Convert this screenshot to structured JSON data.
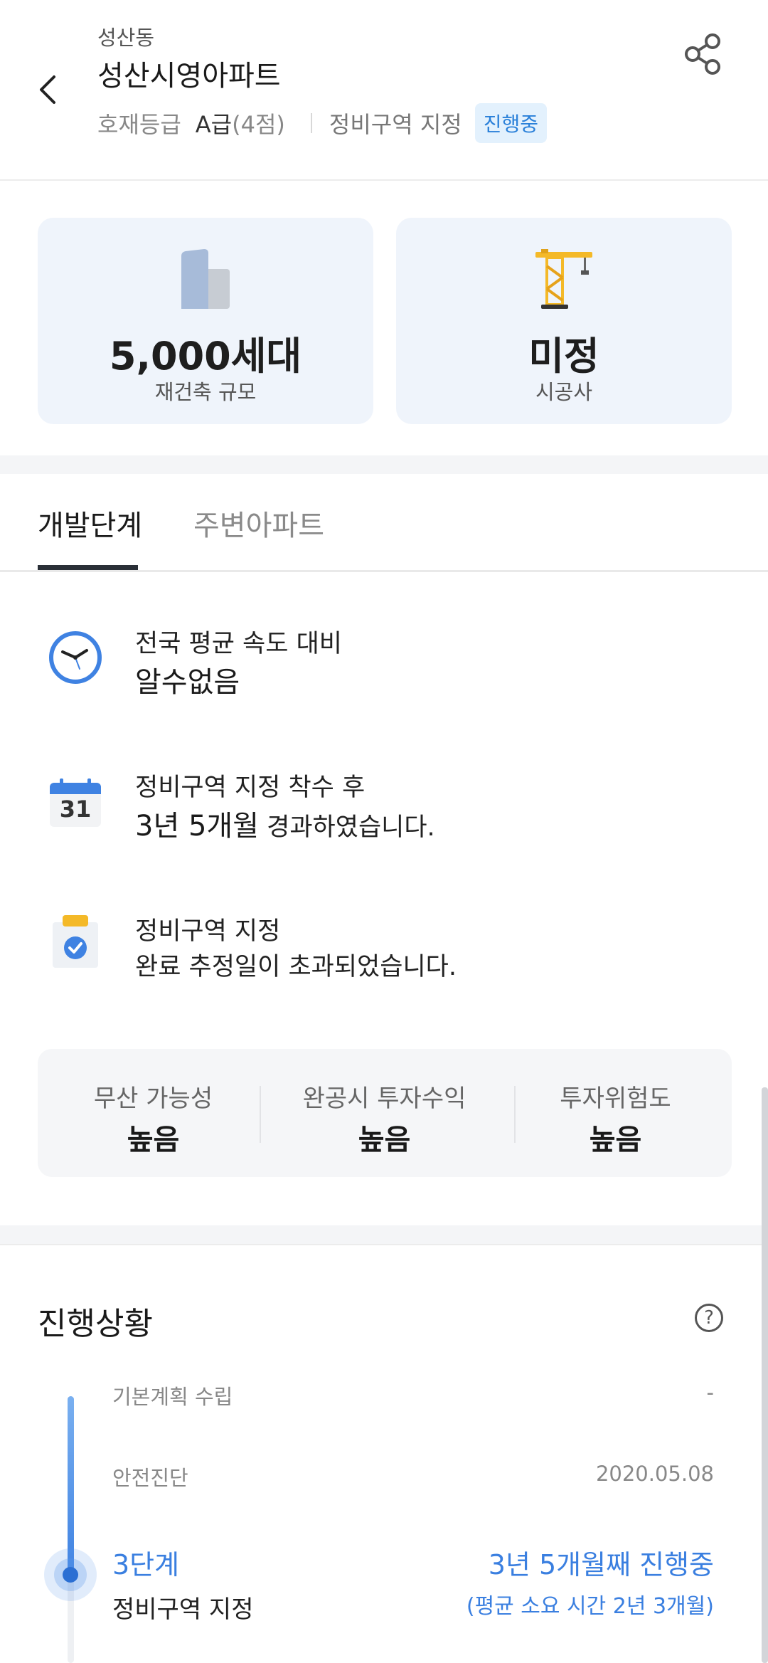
{
  "header": {
    "district": "성산동",
    "title": "성산시영아파트",
    "grade_label": "호재등급",
    "grade_value": "A급",
    "grade_score": "(4점)",
    "zone_label": "정비구역 지정",
    "zone_status": "진행중"
  },
  "cards": [
    {
      "icon": "building-icon",
      "value": "5,000세대",
      "label": "재건축 규모"
    },
    {
      "icon": "crane-icon",
      "value": "미정",
      "label": "시공사"
    }
  ],
  "tabs": [
    {
      "label": "개발단계",
      "active": true
    },
    {
      "label": "주변아파트",
      "active": false
    }
  ],
  "info": {
    "speed": {
      "line1": "전국 평균 속도 대비",
      "line2": "알수없음"
    },
    "elapsed": {
      "line1": "정비구역 지정 착수 후",
      "value": "3년 5개월",
      "suffix": " 경과하였습니다.",
      "calendar_day": "31"
    },
    "estimate": {
      "line1": "정비구역 지정",
      "line2a": "완료 추정일이 ",
      "line2b": "초과되었습니다."
    }
  },
  "stats": [
    {
      "label": "무산 가능성",
      "value": "높음"
    },
    {
      "label": "완공시 투자수익",
      "value": "높음"
    },
    {
      "label": "투자위험도",
      "value": "높음"
    }
  ],
  "progress": {
    "title": "진행상황",
    "help": "?",
    "steps": [
      {
        "name": "기본계획 수립",
        "date": "-"
      },
      {
        "name": "안전진단",
        "date": "2020.05.08"
      }
    ],
    "current": {
      "stage": "3단계",
      "name": "정비구역 지정",
      "status": "3년 5개월째 진행중",
      "average": "(평균 소요 시간 2년 3개월)"
    }
  },
  "colors": {
    "accent": "#3a7fe0",
    "badge_bg": "#e3f1fd",
    "card_bg": "#eff4fb"
  }
}
